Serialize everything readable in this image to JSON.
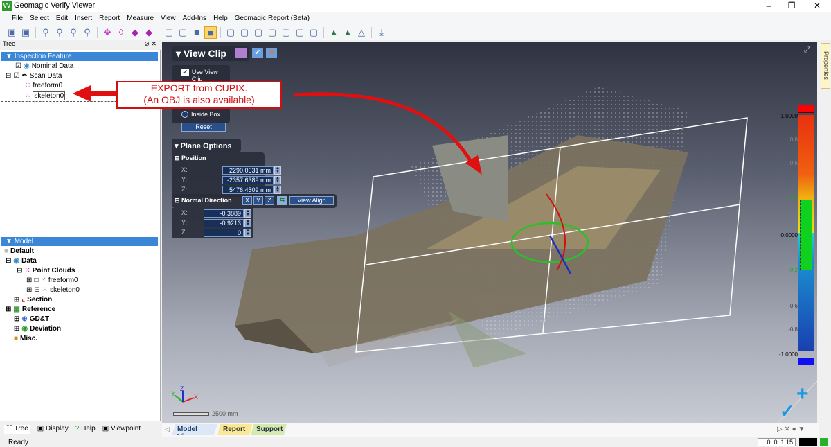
{
  "window": {
    "title": "Geomagic Verify Viewer",
    "logo": "VV"
  },
  "menu": [
    "File",
    "Select",
    "Edit",
    "Insert",
    "Report",
    "Measure",
    "View",
    "Add-Ins",
    "Help",
    "Geomagic Report (Beta)"
  ],
  "tree_panel": {
    "title": "Tree",
    "inspection_header": "Inspection Feature",
    "items": [
      "Nominal Data",
      "Scan Data",
      "freeform0",
      "skeleton0"
    ]
  },
  "model_panel": {
    "header": "Model",
    "items": [
      "Default",
      "Data",
      "Point Clouds",
      "freeform0",
      "skeleton0",
      "Section",
      "Reference",
      "GD&T",
      "Deviation",
      "Misc."
    ]
  },
  "bottom_tabs": [
    "Tree",
    "Display",
    "Help",
    "Viewpoint"
  ],
  "view_clip": {
    "title": "View Clip",
    "use_view_clip": "Use View Clip",
    "use_view_clip_checked": true,
    "inside_box": "Inside Box",
    "reset": "Reset"
  },
  "plane_options": {
    "title": "Plane Options",
    "position_label": "Position",
    "position": {
      "x": "2290.0631 mm",
      "y": "-2357.6389 mm",
      "z": "5476.4509 mm"
    },
    "normal_label": "Normal Direction",
    "axis_buttons": [
      "X",
      "Y",
      "Z"
    ],
    "view_align": "View Align",
    "normal": {
      "x": "-0.3889",
      "y": "-0.9213",
      "z": "0"
    },
    "axis_labels": [
      "X:",
      "Y:",
      "Z:"
    ]
  },
  "annotation": {
    "line1": "EXPORT from CUPIX.",
    "line2": "(An OBJ is also available)",
    "color": "#d01010"
  },
  "color_scale": {
    "labels": [
      "1.0000",
      "0.8",
      "0.6",
      "0.2",
      "0.0000",
      "-0.2",
      "-0.6",
      "-0.8",
      "-1.0000"
    ],
    "tolerance": [
      "0.2",
      "-0.2"
    ]
  },
  "scale_bar": "2500 mm",
  "axes": {
    "x": "X",
    "y": "Y",
    "z": "Z"
  },
  "view_tabs": [
    "Model View",
    "Report",
    "Support"
  ],
  "properties_tab": "Properties",
  "status": {
    "text": "Ready",
    "time": "0: 0: 1.15"
  }
}
